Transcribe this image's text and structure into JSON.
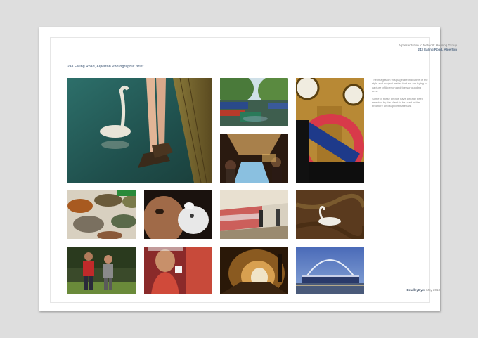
{
  "header": {
    "line1": "A presentation to Network Housing Group",
    "line2": "243 Ealing Road, Alperton"
  },
  "brief_title": "243 Ealing Road, Alperton Photographic Brief",
  "side_text": {
    "p1": "The images on this page are indicative of the style and subject matter that we are trying to capture of Alperton and the surrounding area.",
    "p2": "Some of these photos have already been selected by the client to be used in the brochure and support materials."
  },
  "footer": {
    "brand": "BradleyDyer",
    "date": "May 2013"
  },
  "photos": {
    "swan_legs": "swan-and-legs-photo",
    "canal": "canal-boats-photo",
    "big_ben": "big-ben-underground-photo",
    "market": "market-stall-photo",
    "spices": "spice-sacks-photo",
    "pill": "face-pill-photo",
    "tube": "tube-train-photo",
    "swan": "swan-water-photo",
    "joggers": "joggers-photo",
    "coffee": "coffee-man-photo",
    "tunnel": "tunnel-photo",
    "wembley": "wembley-arch-photo"
  }
}
